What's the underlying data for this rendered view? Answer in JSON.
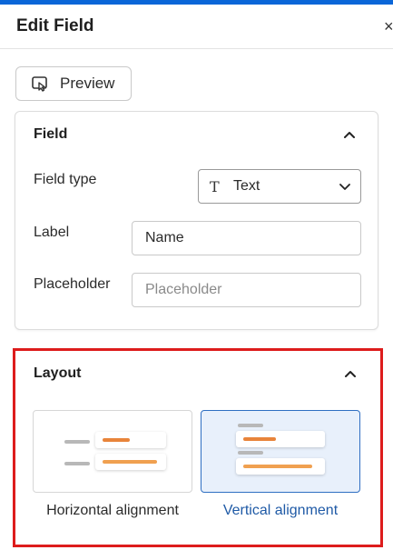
{
  "header": {
    "title": "Edit Field",
    "close_glyph": "×"
  },
  "toolbar": {
    "preview_label": "Preview"
  },
  "field_section": {
    "title": "Field",
    "field_type_label": "Field type",
    "field_type_value": "Text",
    "field_type_icon": "T",
    "label_label": "Label",
    "label_value": "Name",
    "placeholder_label": "Placeholder",
    "placeholder_placeholder": "Placeholder"
  },
  "layout_section": {
    "title": "Layout",
    "options": [
      {
        "label": "Horizontal alignment",
        "selected": false
      },
      {
        "label": "Vertical alignment",
        "selected": true
      }
    ]
  },
  "colors": {
    "accent": "#0a66d8",
    "highlight_border": "#dd1c1c",
    "selected_text": "#1f5aa6",
    "orange": "#f0a050"
  }
}
